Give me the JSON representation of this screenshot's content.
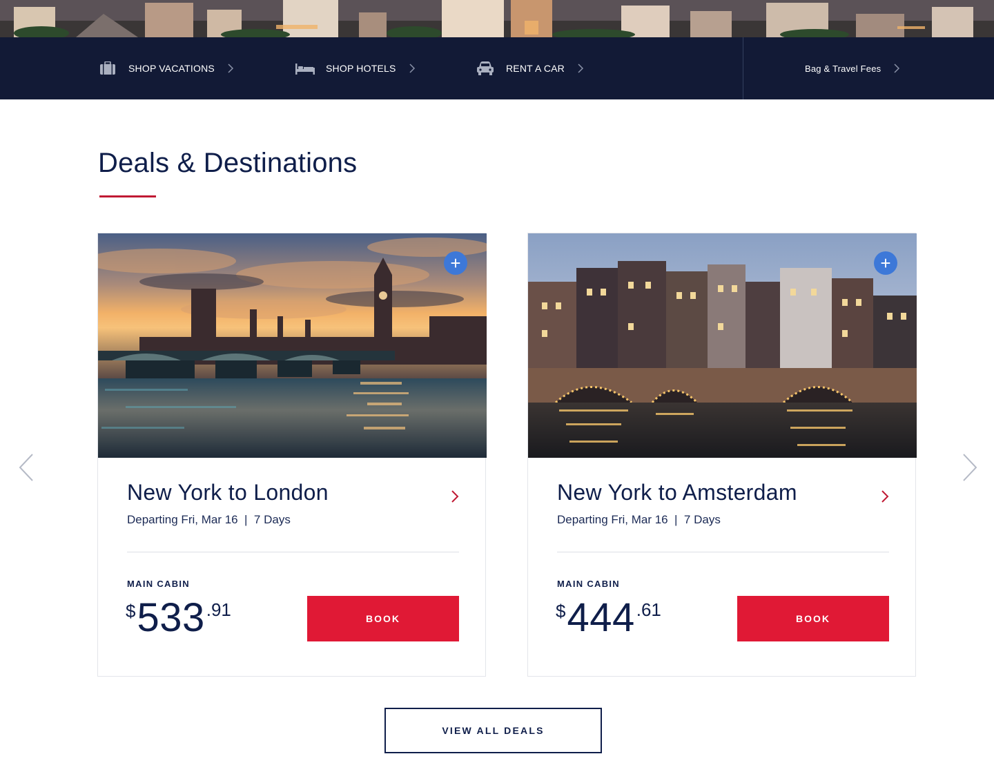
{
  "nav": {
    "items": [
      {
        "label": "SHOP VACATIONS",
        "icon": "suitcase-icon"
      },
      {
        "label": "SHOP HOTELS",
        "icon": "bed-icon"
      },
      {
        "label": "RENT A CAR",
        "icon": "car-icon"
      }
    ],
    "fees_link": "Bag & Travel Fees"
  },
  "section": {
    "title": "Deals & Destinations"
  },
  "deals": [
    {
      "title": "New York to London",
      "subtitle": "Departing Fri, Mar 16  |  7 Days",
      "cabin": "MAIN CABIN",
      "currency": "$",
      "price_whole": "533",
      "price_cents": ".91",
      "book_label": "BOOK",
      "add_icon": "+"
    },
    {
      "title": "New York to Amsterdam",
      "subtitle": "Departing Fri, Mar 16  |  7 Days",
      "cabin": "MAIN CABIN",
      "currency": "$",
      "price_whole": "444",
      "price_cents": ".61",
      "book_label": "BOOK",
      "add_icon": "+"
    }
  ],
  "view_all_label": "VIEW ALL DEALS",
  "colors": {
    "navy": "#121a36",
    "brand_red": "#e01935",
    "accent_red": "#c01933",
    "plus_blue": "#3d78d8"
  }
}
